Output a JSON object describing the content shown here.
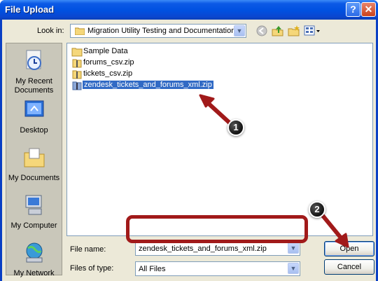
{
  "window": {
    "title": "File Upload",
    "help_glyph": "?",
    "close_glyph": "✕"
  },
  "lookin": {
    "label": "Look in:",
    "value": "Migration Utility Testing and Documentation",
    "arrow": "▼"
  },
  "toolbar": {
    "icons": [
      "back-icon",
      "up-folder-icon",
      "new-folder-icon",
      "views-menu-icon"
    ]
  },
  "places": [
    {
      "label": "My Recent Documents",
      "icon": "recent-documents-icon"
    },
    {
      "label": "Desktop",
      "icon": "desktop-icon"
    },
    {
      "label": "My Documents",
      "icon": "my-documents-icon"
    },
    {
      "label": "My Computer",
      "icon": "my-computer-icon"
    },
    {
      "label": "My Network",
      "icon": "my-network-icon"
    }
  ],
  "files": [
    {
      "name": "Sample Data",
      "type": "folder",
      "selected": false
    },
    {
      "name": "forums_csv.zip",
      "type": "zip",
      "selected": false
    },
    {
      "name": "tickets_csv.zip",
      "type": "zip",
      "selected": false
    },
    {
      "name": "zendesk_tickets_and_forums_xml.zip",
      "type": "zip",
      "selected": true
    }
  ],
  "form": {
    "filename_label": "File name:",
    "filename_value": "zendesk_tickets_and_forums_xml.zip",
    "filetype_label": "Files of type:",
    "filetype_value": "All Files",
    "open_label": "Open",
    "cancel_label": "Cancel",
    "arrow": "▼"
  },
  "callouts": {
    "one": "1",
    "two": "2"
  },
  "colors": {
    "titlebar": "#0050e0",
    "selection": "#316ac5",
    "annotation": "#a11a1a"
  }
}
